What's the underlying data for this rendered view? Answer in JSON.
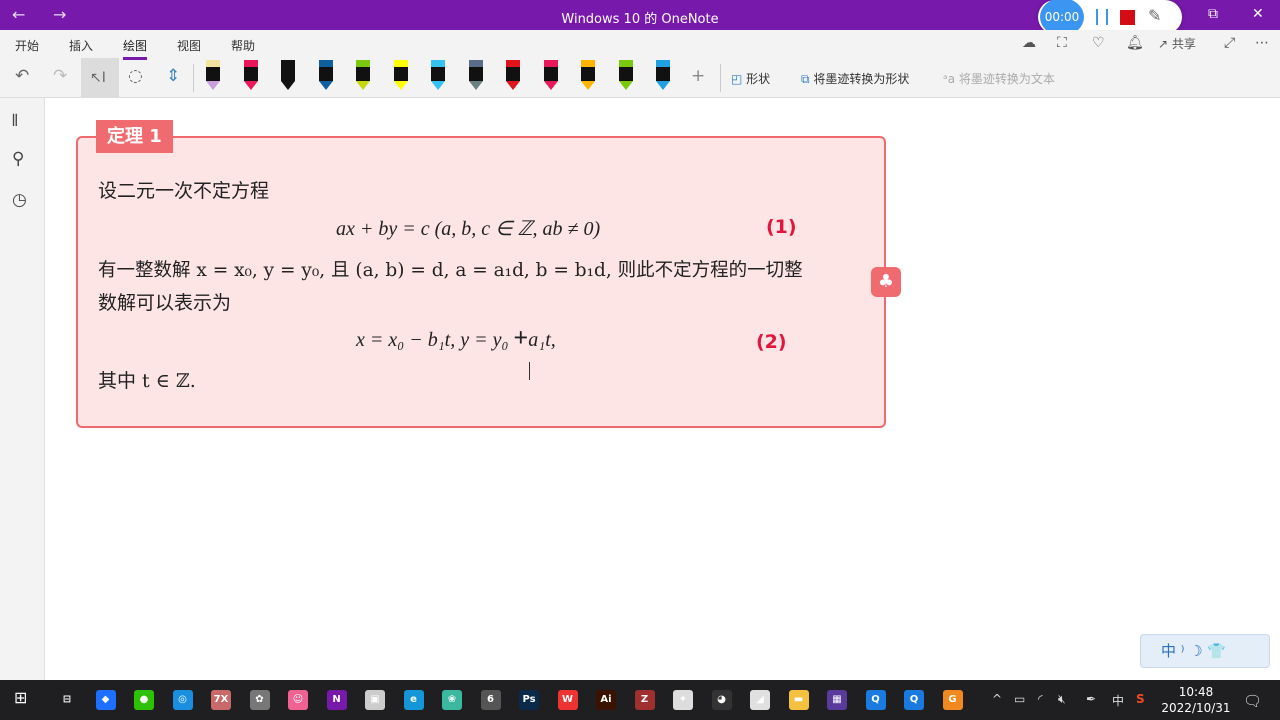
{
  "window": {
    "title": "Windows 10 的 OneNote",
    "back": "←",
    "forward": "→",
    "restore": "⧉",
    "close": "✕"
  },
  "recorder": {
    "timer": "00:00"
  },
  "ribbon": {
    "tabs": [
      "开始",
      "插入",
      "绘图",
      "视图",
      "帮助"
    ],
    "active_tab": "绘图",
    "pens": [
      {
        "cap": "#f2e3a0",
        "color": "#c9a0dc"
      },
      {
        "cap": "#e8185a",
        "color": "#e8185a"
      },
      {
        "cap": "#111111",
        "color": "#111111"
      },
      {
        "cap": "#0f5fa0",
        "color": "#0f5fa0"
      },
      {
        "cap": "#7ac80f",
        "color": "#c8d80f"
      },
      {
        "cap": "#ffff00",
        "color": "#ffff00"
      },
      {
        "cap": "#33c3f0",
        "color": "#33c3f0"
      },
      {
        "cap": "#5b6b8a",
        "color": "#6b8080"
      },
      {
        "cap": "#e0141e",
        "color": "#e0141e"
      },
      {
        "cap": "#e8185a",
        "color": "#e8185a"
      },
      {
        "cap": "#ffb400",
        "color": "#ffb400"
      },
      {
        "cap": "#7ac80f",
        "color": "#7ac80f"
      },
      {
        "cap": "#1fa0e0",
        "color": "#1fa0e0"
      }
    ],
    "add": "+",
    "shapes": "形状",
    "ink_to_shape": "将墨迹转换为形状",
    "ink_to_text": "将墨迹转换为文本",
    "share": "共享",
    "more": "⋯"
  },
  "card": {
    "label": "定理 1",
    "line1": "设二元一次不定方程",
    "eq1": "ax + by = c (a, b, c ∈ ℤ, ab ≠ 0)",
    "ink1": "(1)",
    "line3": "有一整数解 x = x₀, y = y₀, 且 (a, b) = d, a = a₁d, b = b₁d, 则此不定方程的一切整",
    "line4": "数解可以表示为",
    "eq2a": "x = x₀ − b₁t,  y = y₀",
    "eq2plus": "+",
    "eq2b": "a₁t,",
    "ink2": "(2)",
    "line6": "其中 t ∈ ℤ.",
    "tag": "♣"
  },
  "ime": {
    "text": "中 ⁾ ☽ 👕"
  },
  "taskbar": {
    "time": "10:48",
    "date": "2022/10/31",
    "ime": "中",
    "apps": [
      {
        "name": "task-view",
        "label": "⊟",
        "color": "#1f1f22"
      },
      {
        "name": "feishu",
        "label": "◆",
        "color": "#1e6fff"
      },
      {
        "name": "wechat",
        "label": "●",
        "color": "#2dc100"
      },
      {
        "name": "browser",
        "label": "◎",
        "color": "#1a8fe0"
      },
      {
        "name": "7zip",
        "label": "7X",
        "color": "#c96a6a"
      },
      {
        "name": "paint",
        "label": "✿",
        "color": "#777"
      },
      {
        "name": "app-pink",
        "label": "☺",
        "color": "#f06292"
      },
      {
        "name": "onenote",
        "label": "N",
        "color": "#7719aa"
      },
      {
        "name": "monitor",
        "label": "▣",
        "color": "#ccc"
      },
      {
        "name": "edge",
        "label": "e",
        "color": "#1496d9"
      },
      {
        "name": "app-leaf",
        "label": "❀",
        "color": "#3cb8a0"
      },
      {
        "name": "app-6",
        "label": "6",
        "color": "#555"
      },
      {
        "name": "photoshop",
        "label": "Ps",
        "color": "#0b2a4a"
      },
      {
        "name": "wps",
        "label": "W",
        "color": "#e33"
      },
      {
        "name": "illustrator",
        "label": "Ai",
        "color": "#3a1200"
      },
      {
        "name": "app-z",
        "label": "Z",
        "color": "#a03030"
      },
      {
        "name": "app-gear",
        "label": "✦",
        "color": "#ddd"
      },
      {
        "name": "qq",
        "label": "◕",
        "color": "#333"
      },
      {
        "name": "app-red",
        "label": "◢",
        "color": "#e0e0e0"
      },
      {
        "name": "explorer",
        "label": "▬",
        "color": "#f4c040"
      },
      {
        "name": "app-purple",
        "label": "▦",
        "color": "#5a3a9a"
      },
      {
        "name": "app-q1",
        "label": "Q",
        "color": "#1a7ae0"
      },
      {
        "name": "app-q2",
        "label": "Q",
        "color": "#1a7ae0"
      },
      {
        "name": "app-g",
        "label": "G",
        "color": "#f08a20"
      }
    ]
  }
}
